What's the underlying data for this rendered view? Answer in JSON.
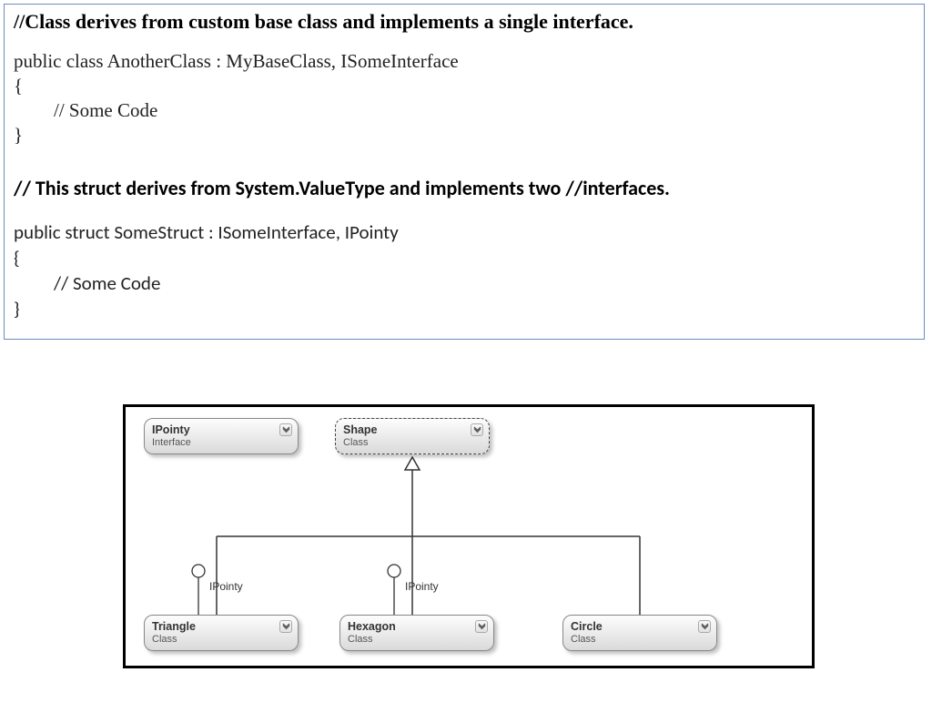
{
  "code": {
    "comment1": "//Class derives from custom base class and implements a single interface.",
    "line1": "public class AnotherClass : MyBaseClass, ISomeInterface",
    "brace_open": "{",
    "body1": "// Some Code",
    "brace_close": "}",
    "comment2": "// This struct derives from System.ValueType and implements two //interfaces.",
    "line2": "public struct SomeStruct : ISomeInterface, IPointy",
    "brace_open2": "{",
    "body2": "// Some Code",
    "brace_close2": "}"
  },
  "diagram": {
    "ipointy": {
      "name": "IPointy",
      "kind": "Interface"
    },
    "shape": {
      "name": "Shape",
      "kind": "Class"
    },
    "triangle": {
      "name": "Triangle",
      "kind": "Class",
      "iface": "IPointy"
    },
    "hexagon": {
      "name": "Hexagon",
      "kind": "Class",
      "iface": "IPointy"
    },
    "circle": {
      "name": "Circle",
      "kind": "Class"
    }
  }
}
